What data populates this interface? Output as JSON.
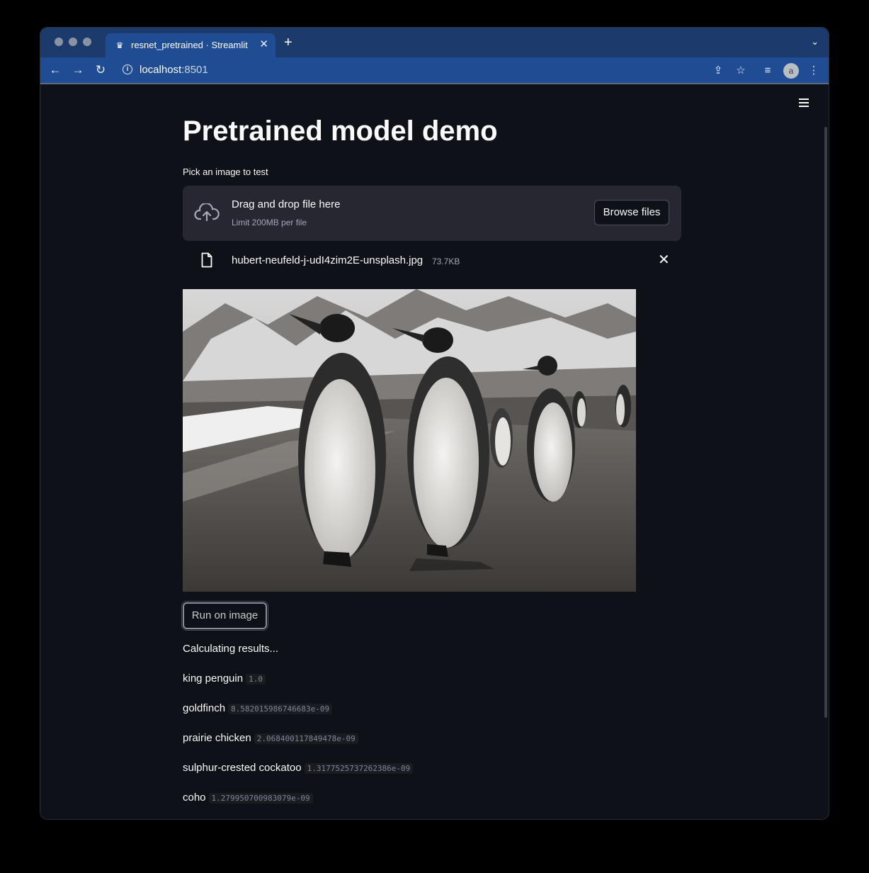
{
  "browser": {
    "tab_title": "resnet_pretrained · Streamlit",
    "url_host": "localhost",
    "url_port": ":8501",
    "avatar_letter": "a"
  },
  "page": {
    "title": "Pretrained model demo",
    "uploader_label": "Pick an image to test",
    "dropzone_title": "Drag and drop file here",
    "dropzone_limit": "Limit 200MB per file",
    "browse_label": "Browse files",
    "file_name": "hubert-neufeld-j-udI4zim2E-unsplash.jpg",
    "file_size": "73.7KB",
    "run_label": "Run on image",
    "status": "Calculating results...",
    "results": [
      {
        "label": "king penguin",
        "value": "1.0"
      },
      {
        "label": "goldfinch",
        "value": "8.582015986746683e-09"
      },
      {
        "label": "prairie chicken",
        "value": "2.068400117849478e-09"
      },
      {
        "label": "sulphur-crested cockatoo",
        "value": "1.3177525737262386e-09"
      },
      {
        "label": "coho",
        "value": "1.279950700983079e-09"
      }
    ]
  },
  "colors": {
    "background": "#0e1117",
    "dropzone": "#262730",
    "browser_chrome": "#1f4c93"
  }
}
